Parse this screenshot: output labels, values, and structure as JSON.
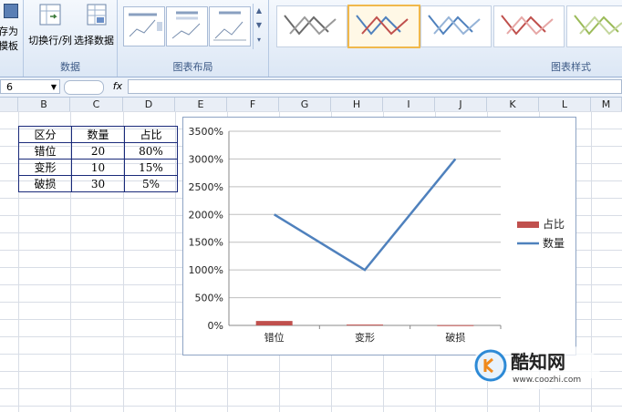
{
  "ribbon": {
    "save_template_line1": "存为",
    "save_template_line2": "模板",
    "switch_row_col": "切换行/列",
    "select_data": "选择数据",
    "group_data": "数据",
    "group_layout": "图表布局",
    "group_styles": "图表样式"
  },
  "formula_bar": {
    "name_box": "6",
    "fx": "fx",
    "formula": ""
  },
  "columns": [
    "B",
    "C",
    "D",
    "E",
    "F",
    "G",
    "H",
    "I",
    "J",
    "K",
    "L",
    "M"
  ],
  "table": {
    "headers": [
      "区分",
      "数量",
      "占比"
    ],
    "rows": [
      [
        "错位",
        "20",
        "80%"
      ],
      [
        "变形",
        "10",
        "15%"
      ],
      [
        "破损",
        "30",
        "5%"
      ]
    ]
  },
  "chart_data": {
    "type": "line",
    "categories": [
      "错位",
      "变形",
      "破损"
    ],
    "series": [
      {
        "name": "占比",
        "type": "bar",
        "values": [
          0.8,
          0.15,
          0.05
        ],
        "color": "#c0504d"
      },
      {
        "name": "数量",
        "type": "line",
        "values": [
          20,
          10,
          30
        ],
        "color": "#4f81bd"
      }
    ],
    "ylim": [
      0,
      35
    ],
    "yticks": [
      "0%",
      "500%",
      "1000%",
      "1500%",
      "2000%",
      "2500%",
      "3000%",
      "3500%"
    ],
    "legend": "right",
    "grid": true
  },
  "watermark": {
    "name": "酷知网",
    "url": "www.coozhi.com"
  }
}
